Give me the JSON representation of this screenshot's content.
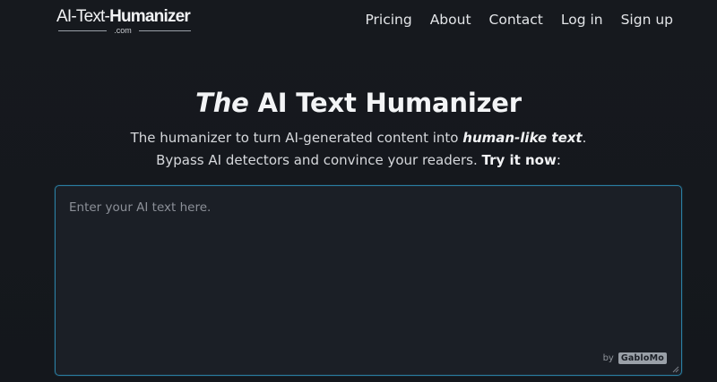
{
  "logo": {
    "part1": "AI-Text-",
    "part2": "Humanizer",
    "sub": ".com"
  },
  "nav": {
    "items": [
      {
        "label": "Pricing"
      },
      {
        "label": "About"
      },
      {
        "label": "Contact"
      },
      {
        "label": "Log in"
      },
      {
        "label": "Sign up"
      }
    ]
  },
  "hero": {
    "title_em": "The",
    "title_rest": " AI Text Humanizer",
    "sub_part1": "The humanizer to turn AI-generated content into ",
    "sub_highlight": "human-like text",
    "sub_part2": ". Bypass AI detectors and convince your readers. ",
    "sub_cta": "Try it now",
    "sub_end": ":"
  },
  "editor": {
    "placeholder": "Enter your AI text here.",
    "value": "",
    "credit_by": "by",
    "credit_brand": "GabloMo"
  },
  "colors": {
    "background": "#15181d",
    "editor_border": "#2b7fa3",
    "editor_bg": "#1b1f26"
  }
}
